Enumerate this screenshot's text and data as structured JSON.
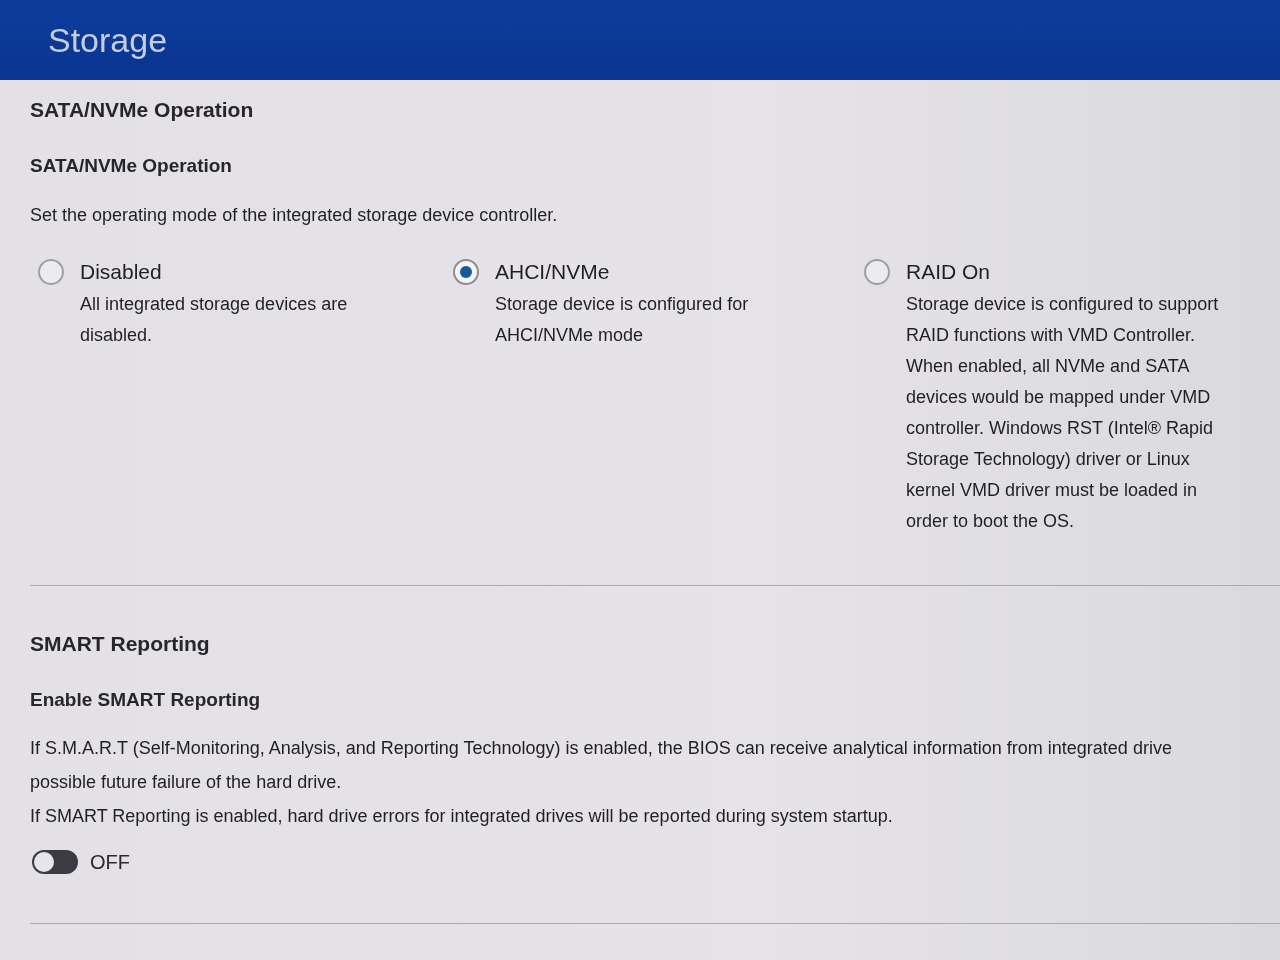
{
  "header": {
    "title": "Storage"
  },
  "sections": [
    {
      "kind": "radio",
      "heading": "SATA/NVMe Operation",
      "setting": "SATA/NVMe Operation",
      "description": [
        "Set the operating mode of the integrated storage device controller."
      ],
      "options": [
        {
          "label": "Disabled",
          "description": "All integrated storage devices are disabled.",
          "selected": false
        },
        {
          "label": "AHCI/NVMe",
          "description": "Storage device is configured for AHCI/NVMe mode",
          "selected": true
        },
        {
          "label": "RAID On",
          "description": "Storage device is configured to support RAID functions with VMD Controller. When enabled, all NVMe and SATA devices would be mapped under VMD controller. Windows RST (Intel® Rapid Storage Technology) driver or Linux kernel VMD driver must be loaded in order to boot the OS.",
          "selected": false
        }
      ]
    },
    {
      "kind": "toggle",
      "heading": "SMART Reporting",
      "setting": "Enable SMART Reporting",
      "description": [
        "If S.M.A.R.T (Self-Monitoring, Analysis, and Reporting Technology) is enabled, the BIOS can receive analytical information from integrated drive",
        "possible future failure of the hard drive.",
        "If SMART Reporting is enabled, hard drive errors for integrated drives will be reported during system startup."
      ],
      "toggle": {
        "on": false,
        "label": "OFF"
      }
    }
  ]
}
